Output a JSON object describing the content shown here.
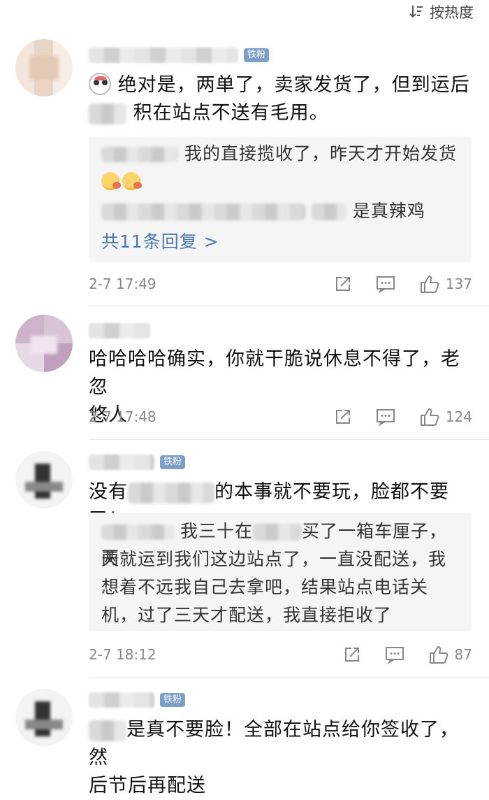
{
  "sort": {
    "label": "按热度"
  },
  "comments": [
    {
      "badge": "铁粉",
      "text_line1": "绝对是，两单了，卖家发货了，但到运后",
      "text_line2": "积在站点不送有毛用。",
      "replies": {
        "reply1_text": "我的直接揽收了，昨天才开始发货",
        "reply2_text": "是真辣鸡",
        "more": "共11条回复 >"
      },
      "time": "2-7 17:49",
      "likes": "137"
    },
    {
      "text_line1": "哈哈哈哈确实，你就干脆说休息不得了，老忽",
      "text_line2": "悠人",
      "time": "2-7 17:48",
      "likes": "124"
    },
    {
      "badge": "铁粉",
      "text_pre": "没有",
      "text_post": "的本事就不要玩，脸都不要了！",
      "reply": {
        "line1_pre": "我三十在",
        "line1_post": "买了一箱车厘子，两",
        "line2": "天就运到我们这边站点了，一直没配送，我",
        "line3": "想着不远我自己去拿吧，结果站点电话关",
        "line4": "机，过了三天才配送，我直接拒收了"
      },
      "time": "2-7 18:12",
      "likes": "87"
    },
    {
      "badge": "铁粉",
      "text_line1": "是真不要脸！全部在站点给你签收了，然",
      "text_line2": "后节后再配送"
    }
  ],
  "icons": [
    "sort-icon",
    "share-icon",
    "comment-icon",
    "like-icon",
    "emoji-icon"
  ],
  "colors": {
    "link": "#4a79b3",
    "badge": "#7c9fc8",
    "meta": "#888888"
  }
}
